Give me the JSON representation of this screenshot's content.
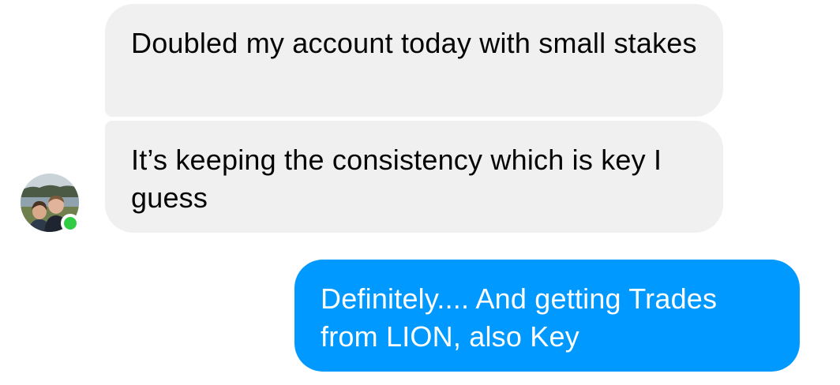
{
  "conversation": {
    "messages": [
      {
        "sender": "contact",
        "text": "Doubled my account today with small stakes"
      },
      {
        "sender": "contact",
        "text": "It’s keeping the consistency which is key I guess"
      },
      {
        "sender": "me",
        "text": "Definitely.... And getting Trades from LION, also Key"
      }
    ],
    "contact": {
      "online": true
    },
    "colors": {
      "incoming_bubble": "#f0f0f0",
      "outgoing_bubble": "#0099ff",
      "online_indicator": "#31cc46"
    }
  }
}
